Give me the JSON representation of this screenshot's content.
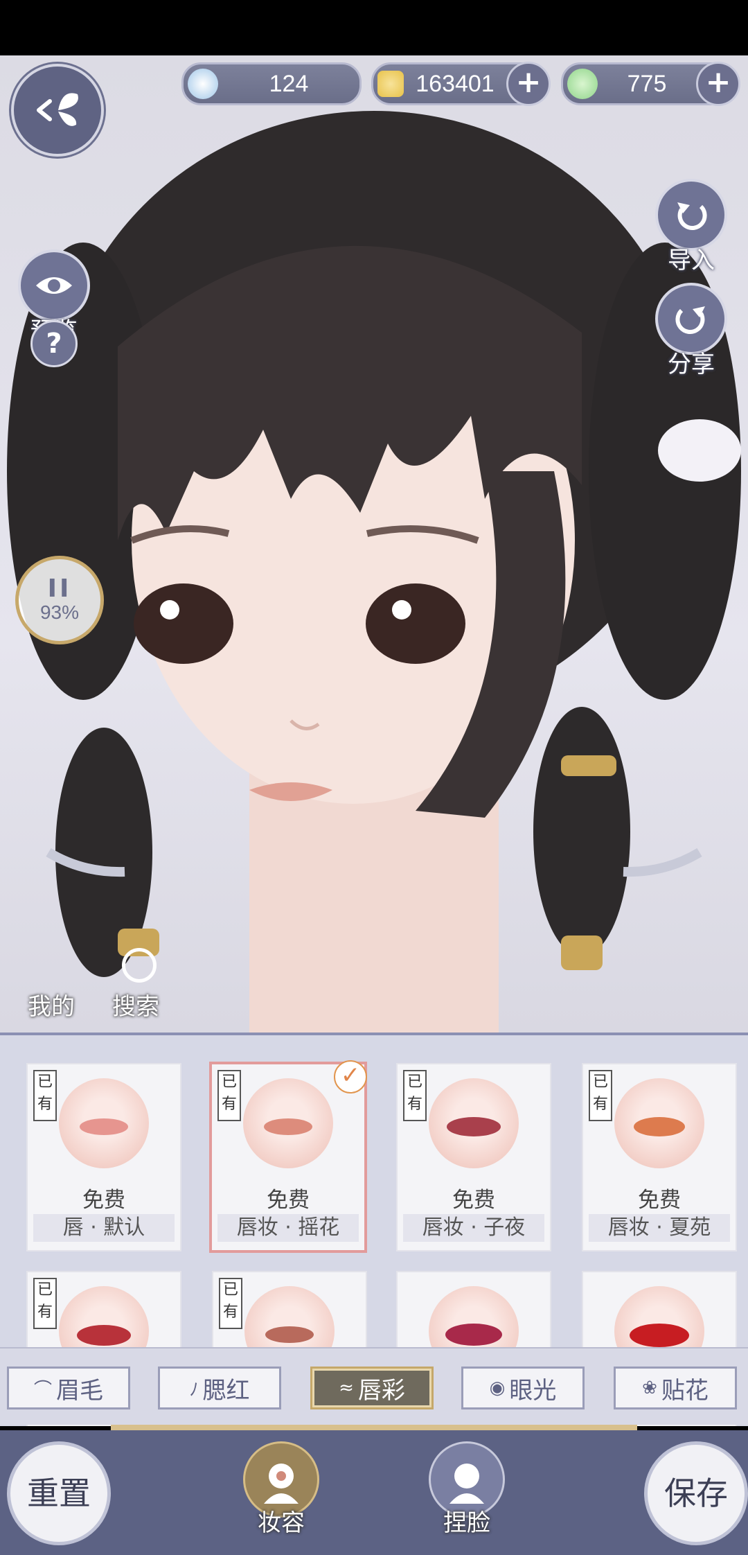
{
  "currencies": [
    {
      "value": "124",
      "has_plus": false,
      "color": "#9fc6e8"
    },
    {
      "value": "163401",
      "has_plus": true,
      "color": "#e8c24a"
    },
    {
      "value": "775",
      "has_plus": true,
      "color": "#8fd48a"
    }
  ],
  "side_right": {
    "import_label": "导入",
    "share_label": "分享"
  },
  "side_left": {
    "preview_label": "预览",
    "help_label": "?"
  },
  "progress": {
    "pause_symbol": "II",
    "percent": "93%"
  },
  "bottom_links": {
    "mine": "我的",
    "search": "搜索"
  },
  "cards": [
    {
      "owned": "已有",
      "price": "免费",
      "name": "唇 · 默认",
      "lip_color": "#e6958f",
      "selected": false
    },
    {
      "owned": "已有",
      "price": "免费",
      "name": "唇妆 · 摇花",
      "lip_color": "#dd8c7c",
      "selected": true
    },
    {
      "owned": "已有",
      "price": "免费",
      "name": "唇妆 · 子夜",
      "lip_color": "#a9404c",
      "selected": false
    },
    {
      "owned": "已有",
      "price": "免费",
      "name": "唇妆 · 夏苑",
      "lip_color": "#dd7b4e",
      "selected": false
    },
    {
      "owned": "已有",
      "lip_color": "#b8323a"
    },
    {
      "owned": "已有",
      "lip_color": "#b86a5c"
    },
    {
      "owned": "",
      "lip_color": "#a8294a"
    },
    {
      "owned": "",
      "lip_color": "#c71d22"
    }
  ],
  "tabs": [
    {
      "icon": "⌒",
      "label": "眉毛",
      "active": false
    },
    {
      "icon": "ﾉ",
      "label": "腮红",
      "active": false
    },
    {
      "icon": "≈",
      "label": "唇彩",
      "active": true
    },
    {
      "icon": "◉",
      "label": "眼光",
      "active": false
    },
    {
      "icon": "❀",
      "label": "贴花",
      "active": false
    }
  ],
  "bottom_bar": {
    "reset_label": "重置",
    "makeup_label": "妆容",
    "face_label": "捏脸",
    "save_label": "保存"
  }
}
